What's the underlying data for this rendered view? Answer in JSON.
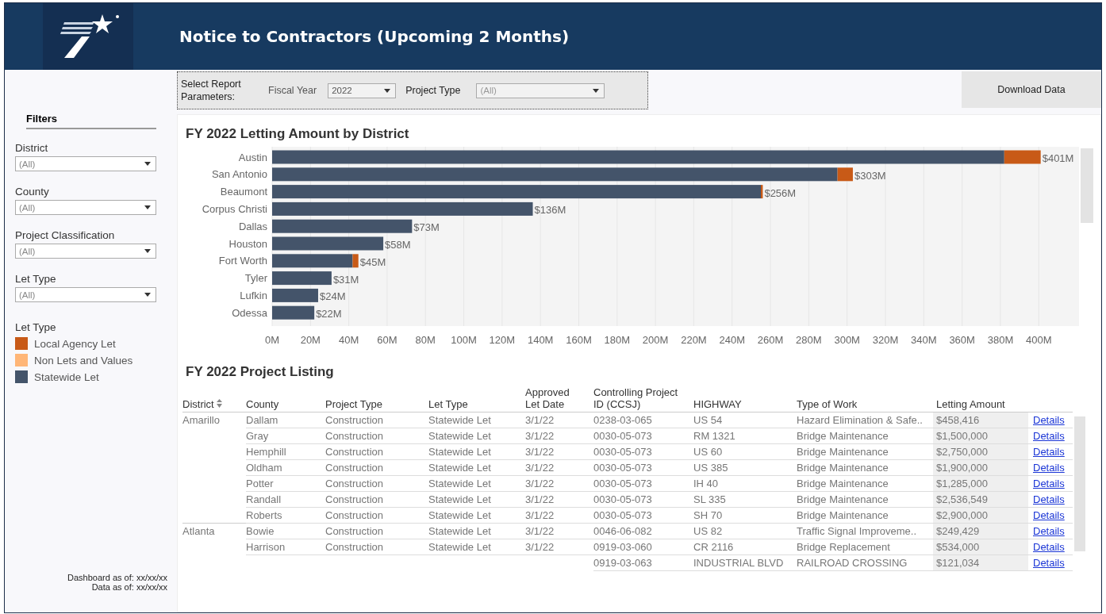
{
  "header": {
    "title": "Notice to Contractors (Upcoming 2 Months)"
  },
  "parameters": {
    "label": "Select Report Parameters:",
    "fields": [
      {
        "label": "Fiscal Year",
        "value": "2022",
        "kind": "value"
      },
      {
        "label": "Project Type",
        "value": "(All)",
        "kind": "muted"
      }
    ]
  },
  "download_button": "Download Data",
  "sidebar": {
    "title": "Filters",
    "filters": [
      {
        "label": "District",
        "value": "(All)"
      },
      {
        "label": "County",
        "value": "(All)"
      },
      {
        "label": "Project Classification",
        "value": "(All)"
      },
      {
        "label": "Let Type",
        "value": "(All)"
      }
    ],
    "legend_title": "Let Type",
    "footnotes": [
      "Dashboard as of: xx/xx/xx",
      "Data as of: xx/xx/xx"
    ]
  },
  "chart": {
    "chart_data": {
      "type": "bar",
      "orientation": "horizontal",
      "stacked": true,
      "title": "FY 2022  Letting Amount by District",
      "categories": [
        "Austin",
        "San Antonio",
        "Beaumont",
        "Corpus Christi",
        "Dallas",
        "Houston",
        "Fort Worth",
        "Tyler",
        "Lufkin",
        "Odessa"
      ],
      "grid": true,
      "series": [
        {
          "name": "Local Agency Let",
          "color": "#c85a17",
          "values": [
            19,
            8,
            1,
            0,
            0,
            0,
            3,
            0,
            0,
            0
          ]
        },
        {
          "name": "Non Lets and Values",
          "color": "#ffb677",
          "values": [
            0,
            0,
            0,
            0,
            0,
            0,
            0,
            0,
            0,
            0
          ]
        },
        {
          "name": "Statewide Let",
          "color": "#44546a",
          "values": [
            382,
            295,
            255,
            136,
            73,
            58,
            42,
            31,
            24,
            22
          ]
        }
      ],
      "value_labels": [
        "$401M",
        "$303M",
        "$256M",
        "$136M",
        "$73M",
        "$58M",
        "$45M",
        "$31M",
        "$24M",
        "$22M"
      ],
      "xlim": [
        0,
        421
      ],
      "xticks": [
        {
          "value": 0,
          "label": "0M"
        },
        {
          "value": 20,
          "label": "20M"
        },
        {
          "value": 40,
          "label": "40M"
        },
        {
          "value": 60,
          "label": "60M"
        },
        {
          "value": 80,
          "label": "80M"
        },
        {
          "value": 100,
          "label": "100M"
        },
        {
          "value": 120,
          "label": "120M"
        },
        {
          "value": 140,
          "label": "140M"
        },
        {
          "value": 160,
          "label": "160M"
        },
        {
          "value": 180,
          "label": "180M"
        },
        {
          "value": 200,
          "label": "200M"
        },
        {
          "value": 220,
          "label": "220M"
        },
        {
          "value": 240,
          "label": "240M"
        },
        {
          "value": 260,
          "label": "260M"
        },
        {
          "value": 280,
          "label": "280M"
        },
        {
          "value": 300,
          "label": "300M"
        },
        {
          "value": 320,
          "label": "320M"
        },
        {
          "value": 340,
          "label": "340M"
        },
        {
          "value": 360,
          "label": "360M"
        },
        {
          "value": 380,
          "label": "380M"
        },
        {
          "value": 400,
          "label": "400M"
        }
      ]
    }
  },
  "listing": {
    "title": "FY 2022 Project Listing",
    "columns": [
      "District",
      "County",
      "Project Type",
      "Let Type",
      "Approved Let Date",
      "Controlling Project ID (CCSJ)",
      "HIGHWAY",
      "Type of Work",
      "Letting Amount"
    ],
    "rows": [
      [
        "Amarillo",
        "Dallam",
        "Construction",
        "Statewide Let",
        "3/1/22",
        "0238-03-065",
        "US 54",
        "Hazard Elimination & Safe..",
        "$458,416",
        "Details"
      ],
      [
        "",
        "Gray",
        "Construction",
        "Statewide Let",
        "3/1/22",
        "0030-05-073",
        "RM 1321",
        "Bridge Maintenance",
        "$1,500,000",
        "Details"
      ],
      [
        "",
        "Hemphill",
        "Construction",
        "Statewide Let",
        "3/1/22",
        "0030-05-073",
        "US 60",
        "Bridge Maintenance",
        "$2,750,000",
        "Details"
      ],
      [
        "",
        "Oldham",
        "Construction",
        "Statewide Let",
        "3/1/22",
        "0030-05-073",
        "US 385",
        "Bridge Maintenance",
        "$1,900,000",
        "Details"
      ],
      [
        "",
        "Potter",
        "Construction",
        "Statewide Let",
        "3/1/22",
        "0030-05-073",
        "IH 40",
        "Bridge Maintenance",
        "$1,285,000",
        "Details"
      ],
      [
        "",
        "Randall",
        "Construction",
        "Statewide Let",
        "3/1/22",
        "0030-05-073",
        "SL 335",
        "Bridge Maintenance",
        "$2,536,549",
        "Details"
      ],
      [
        "",
        "Roberts",
        "Construction",
        "Statewide Let",
        "3/1/22",
        "0030-05-073",
        "SH 70",
        "Bridge Maintenance",
        "$2,900,000",
        "Details"
      ],
      [
        "Atlanta",
        "Bowie",
        "Construction",
        "Statewide Let",
        "3/1/22",
        "0046-06-082",
        "US 82",
        "Traffic Signal Improveme..",
        "$249,429",
        "Details"
      ],
      [
        "",
        "Harrison",
        "Construction",
        "Statewide Let",
        "3/1/22",
        "0919-03-060",
        "CR 2116",
        "Bridge Replacement",
        "$534,000",
        "Details"
      ],
      [
        "",
        "",
        "",
        "",
        "",
        "0919-03-063",
        "INDUSTRIAL BLVD",
        "RAILROAD CROSSING",
        "$121,034",
        "Details"
      ]
    ]
  }
}
